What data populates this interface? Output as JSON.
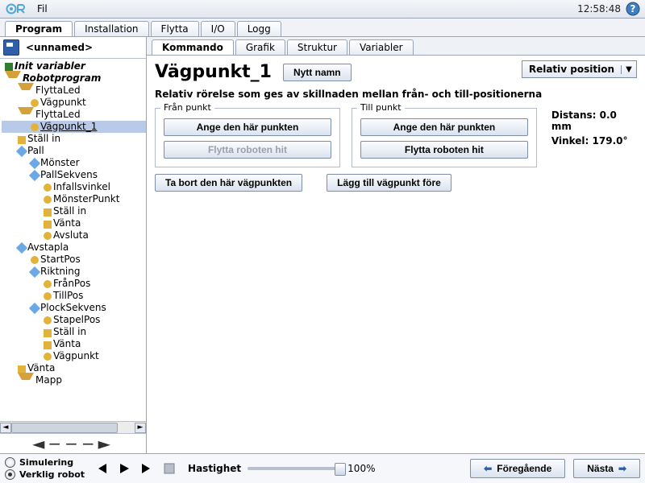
{
  "topbar": {
    "menu_file": "Fil",
    "clock": "12:58:48"
  },
  "main_tabs": [
    "Program",
    "Installation",
    "Flytta",
    "I/O",
    "Logg"
  ],
  "main_tab_active": 0,
  "file_name": "<unnamed>",
  "tree": [
    {
      "d": 0,
      "ic": "bar",
      "label": "Init variabler",
      "cls": "bi"
    },
    {
      "d": 0,
      "ic": "tri",
      "label": "Robotprogram",
      "cls": "bi"
    },
    {
      "d": 1,
      "ic": "tri",
      "label": "FlyttaLed"
    },
    {
      "d": 2,
      "ic": "dot",
      "label": "Vägpunkt"
    },
    {
      "d": 1,
      "ic": "tri",
      "label": "FlyttaLed"
    },
    {
      "d": 2,
      "ic": "dot",
      "label": "Vägpunkt_1",
      "sel": true,
      "ul": true
    },
    {
      "d": 1,
      "ic": "dash",
      "label": "Ställ in"
    },
    {
      "d": 1,
      "ic": "dia",
      "label": "Pall"
    },
    {
      "d": 2,
      "ic": "dia",
      "label": "Mönster"
    },
    {
      "d": 2,
      "ic": "dia",
      "label": "PallSekvens"
    },
    {
      "d": 3,
      "ic": "dot",
      "label": "Infallsvinkel"
    },
    {
      "d": 3,
      "ic": "dot",
      "label": "MönsterPunkt"
    },
    {
      "d": 3,
      "ic": "dash",
      "label": "Ställ in"
    },
    {
      "d": 3,
      "ic": "dash",
      "label": "Vänta"
    },
    {
      "d": 3,
      "ic": "dot",
      "label": "Avsluta"
    },
    {
      "d": 1,
      "ic": "dia",
      "label": "Avstapla"
    },
    {
      "d": 2,
      "ic": "dot",
      "label": "StartPos"
    },
    {
      "d": 2,
      "ic": "dia",
      "label": "Riktning"
    },
    {
      "d": 3,
      "ic": "dot",
      "label": "FrånPos"
    },
    {
      "d": 3,
      "ic": "dot",
      "label": "TillPos"
    },
    {
      "d": 2,
      "ic": "dia",
      "label": "PlockSekvens"
    },
    {
      "d": 3,
      "ic": "dot",
      "label": "StapelPos"
    },
    {
      "d": 3,
      "ic": "dash",
      "label": "Ställ in"
    },
    {
      "d": 3,
      "ic": "dash",
      "label": "Vänta"
    },
    {
      "d": 3,
      "ic": "dot",
      "label": "Vägpunkt"
    },
    {
      "d": 1,
      "ic": "dash",
      "label": "Vänta"
    },
    {
      "d": 1,
      "ic": "tri",
      "label": "Mapp"
    }
  ],
  "step_arrows": "◄−−−►",
  "sub_tabs": [
    "Kommando",
    "Grafik",
    "Struktur",
    "Variabler"
  ],
  "sub_tab_active": 0,
  "pane": {
    "title": "Vägpunkt_1",
    "rename_btn": "Nytt namn",
    "position_mode": "Relativ position",
    "description": "Relativ rörelse som ges av skillnaden mellan från- och till-positionerna",
    "from": {
      "legend": "Från punkt",
      "set_btn": "Ange den här punkten",
      "move_btn": "Flytta roboten hit",
      "move_enabled": false
    },
    "to": {
      "legend": "Till punkt",
      "set_btn": "Ange den här punkten",
      "move_btn": "Flytta roboten hit",
      "move_enabled": true
    },
    "distance_label": "Distans:",
    "distance_value": "0.0 mm",
    "angle_label": "Vinkel:",
    "angle_value": "179.0°",
    "remove_btn": "Ta bort den här vägpunkten",
    "add_before_btn": "Lägg till vägpunkt före"
  },
  "footer": {
    "sim_label": "Simulering",
    "real_label": "Verklig robot",
    "mode": "real",
    "speed_label": "Hastighet",
    "speed_value": "100%",
    "prev_btn": "Föregående",
    "next_btn": "Nästa"
  }
}
